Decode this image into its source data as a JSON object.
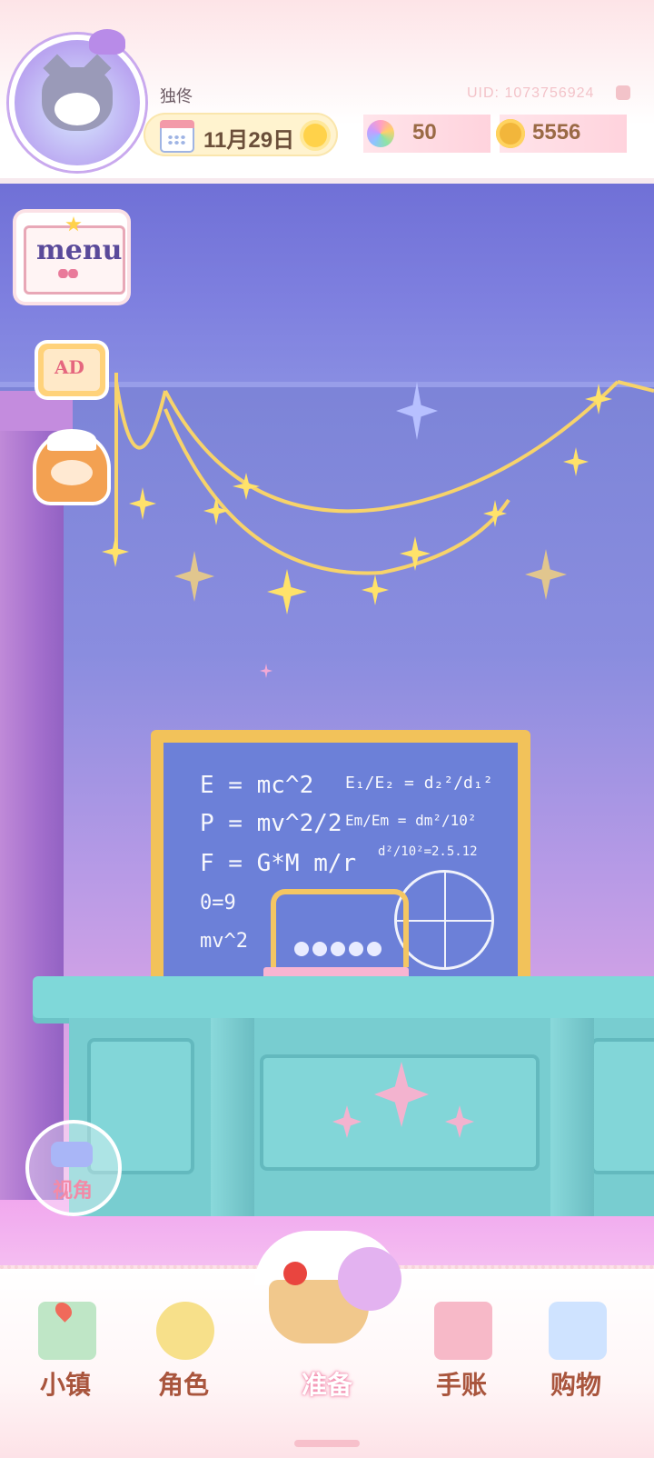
{
  "header": {
    "player_name": "独佟",
    "uid_label": "UID: 1073756924",
    "date": "11月29日",
    "weather_icon": "sun-icon",
    "gems": "50",
    "coins": "5556"
  },
  "side_buttons": {
    "menu_label": "menu",
    "ad_label": "AD"
  },
  "chalkboard": {
    "lines": [
      "E = mc^2",
      "P = mv^2/2",
      "F = G*M m/r",
      "0=9",
      "mv^2"
    ],
    "right_lines": [
      "E₁/E₂ = d₂²/d₁²",
      "Em/Em = dm²/10²",
      "d²/10²=2.5.12"
    ]
  },
  "view_button": {
    "label": "视角"
  },
  "bottom_nav": {
    "items": [
      {
        "label": "小镇",
        "icon": "map-icon"
      },
      {
        "label": "角色",
        "icon": "doll-icon"
      },
      {
        "label": "准备",
        "icon": "basket-icon",
        "active": true
      },
      {
        "label": "手账",
        "icon": "notebook-icon"
      },
      {
        "label": "购物",
        "icon": "shopping-bag-icon"
      }
    ]
  }
}
